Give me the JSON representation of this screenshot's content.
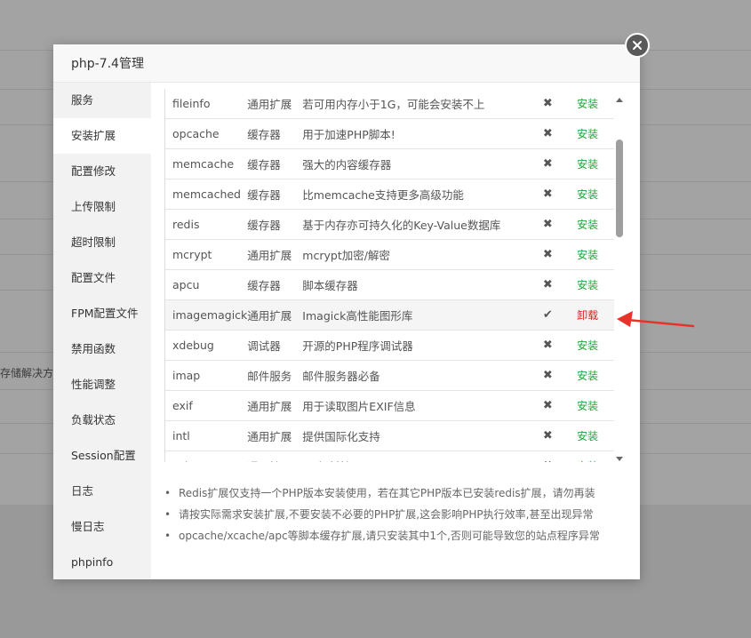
{
  "background": {
    "partial_text": "存储解决方"
  },
  "modal": {
    "title": "php-7.4管理"
  },
  "sidebar": {
    "items": [
      {
        "label": "服务"
      },
      {
        "label": "安装扩展"
      },
      {
        "label": "配置修改"
      },
      {
        "label": "上传限制"
      },
      {
        "label": "超时限制"
      },
      {
        "label": "配置文件"
      },
      {
        "label": "FPM配置文件"
      },
      {
        "label": "禁用函数"
      },
      {
        "label": "性能调整"
      },
      {
        "label": "负载状态"
      },
      {
        "label": "Session配置"
      },
      {
        "label": "日志"
      },
      {
        "label": "慢日志"
      },
      {
        "label": "phpinfo"
      }
    ],
    "active": "安装扩展"
  },
  "extensions": [
    {
      "name": "fileinfo",
      "type": "通用扩展",
      "desc": "若可用内存小于1G，可能会安装不上",
      "status": "✖",
      "op": "安装"
    },
    {
      "name": "opcache",
      "type": "缓存器",
      "desc": "用于加速PHP脚本!",
      "status": "✖",
      "op": "安装"
    },
    {
      "name": "memcache",
      "type": "缓存器",
      "desc": "强大的内容缓存器",
      "status": "✖",
      "op": "安装"
    },
    {
      "name": "memcached",
      "type": "缓存器",
      "desc": "比memcache支持更多高级功能",
      "status": "✖",
      "op": "安装"
    },
    {
      "name": "redis",
      "type": "缓存器",
      "desc": "基于内存亦可持久化的Key-Value数据库",
      "status": "✖",
      "op": "安装"
    },
    {
      "name": "mcrypt",
      "type": "通用扩展",
      "desc": "mcrypt加密/解密",
      "status": "✖",
      "op": "安装"
    },
    {
      "name": "apcu",
      "type": "缓存器",
      "desc": "脚本缓存器",
      "status": "✖",
      "op": "安装"
    },
    {
      "name": "imagemagick",
      "type": "通用扩展",
      "desc": "Imagick高性能图形库",
      "status": "✔",
      "op": "卸载"
    },
    {
      "name": "xdebug",
      "type": "调试器",
      "desc": "开源的PHP程序调试器",
      "status": "✖",
      "op": "安装"
    },
    {
      "name": "imap",
      "type": "邮件服务",
      "desc": "邮件服务器必备",
      "status": "✖",
      "op": "安装"
    },
    {
      "name": "exif",
      "type": "通用扩展",
      "desc": "用于读取图片EXIF信息",
      "status": "✖",
      "op": "安装"
    },
    {
      "name": "intl",
      "type": "通用扩展",
      "desc": "提供国际化支持",
      "status": "✖",
      "op": "安装"
    },
    {
      "name": "xsl",
      "type": "通用扩展",
      "desc": "xsl解析扩展",
      "status": "✖",
      "op": "安装"
    }
  ],
  "notes": [
    "Redis扩展仅支持一个PHP版本安装使用，若在其它PHP版本已安装redis扩展，请勿再装",
    "请按实际需求安装扩展,不要安装不必要的PHP扩展,这会影响PHP执行效率,甚至出现异常",
    "opcache/xcache/apc等脚本缓存扩展,请只安装其中1个,否则可能导致您的站点程序异常"
  ],
  "colors": {
    "install": "#20a53a",
    "uninstall": "#e02020",
    "annotation_arrow": "#e8322a"
  }
}
